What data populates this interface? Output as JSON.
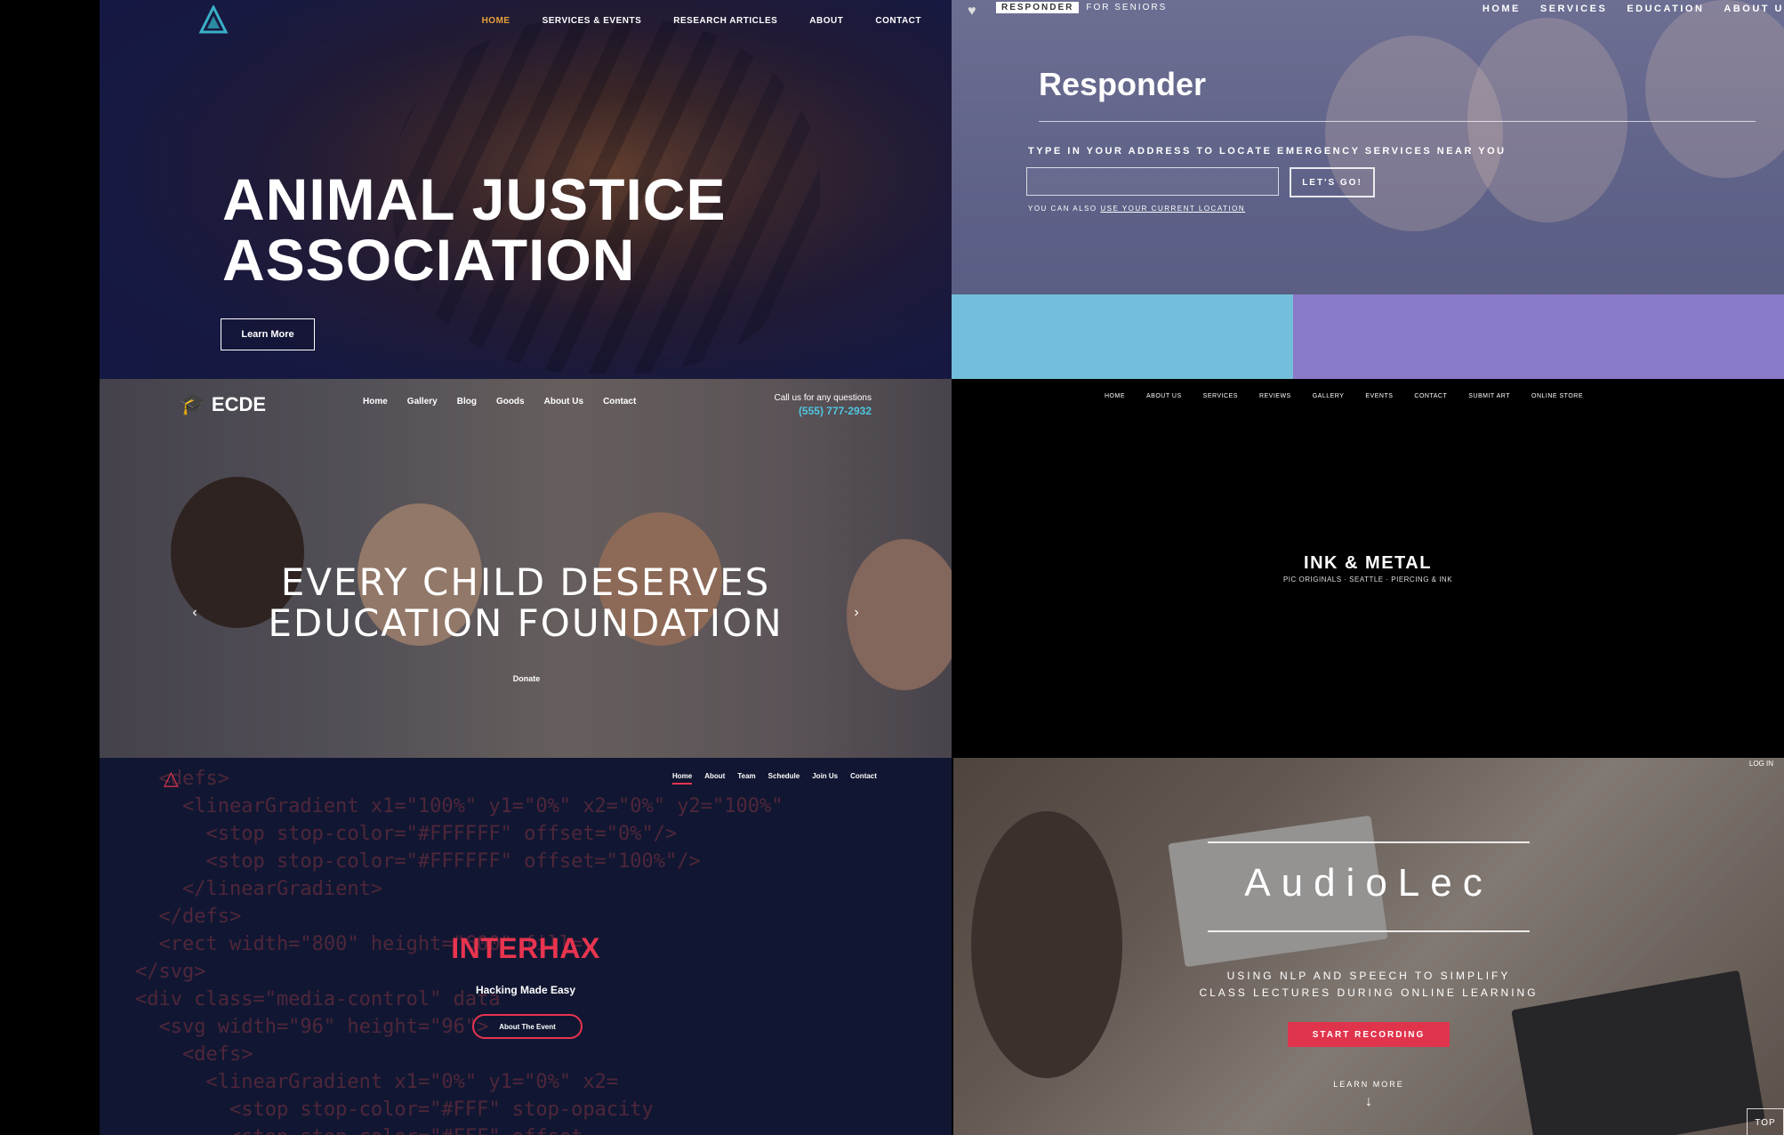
{
  "animal_justice": {
    "nav": [
      "HOME",
      "SERVICES & EVENTS",
      "RESEARCH ARTICLES",
      "ABOUT",
      "CONTACT"
    ],
    "title_line1": "ANIMAL JUSTICE",
    "title_line2": "ASSOCIATION",
    "button": "Learn More",
    "accent": "#e8a13a"
  },
  "responder": {
    "brand_box": "RESPONDER",
    "brand_suffix": "FOR SENIORS",
    "nav": [
      "HOME",
      "SERVICES",
      "EDUCATION",
      "ABOUT U"
    ],
    "title": "Responder",
    "label": "TYPE IN YOUR ADDRESS TO LOCATE EMERGENCY SERVICES NEAR YOU",
    "go_button": "LET'S GO!",
    "note_prefix": "YOU CAN ALSO",
    "note_link": "USE YOUR CURRENT LOCATION",
    "band_colors": [
      "#73bfdb",
      "#8a78c8"
    ]
  },
  "ecde": {
    "logo": "ECDE",
    "nav": [
      "Home",
      "Gallery",
      "Blog",
      "Goods",
      "About Us",
      "Contact"
    ],
    "call_label": "Call us for any questions",
    "phone": "(555) 777-2932",
    "title_line1": "EVERY CHILD DESERVES",
    "title_line2": "EDUCATION FOUNDATION",
    "donate": "Donate",
    "accent": "#5fd0e8"
  },
  "ink_metal": {
    "nav": [
      "HOME",
      "ABOUT US",
      "SERVICES",
      "REVIEWS",
      "GALLERY",
      "EVENTS",
      "CONTACT",
      "SUBMIT ART",
      "ONLINE STORE"
    ],
    "title": "INK & METAL",
    "subtitle": "PIC ORIGINALS · SEATTLE · PIERCING & INK"
  },
  "interhax": {
    "nav": [
      "Home",
      "About",
      "Team",
      "Schedule",
      "Join Us",
      "Contact"
    ],
    "code_lines": [
      "  <defs>",
      "    <linearGradient x1=\"100%\" y1=\"0%\" x2=\"0%\" y2=\"100%\"",
      "      <stop stop-color=\"#FFFFFF\" offset=\"0%\"/>",
      "      <stop stop-color=\"#FFFFFF\" offset=\"100%\"/>",
      "    </linearGradient>",
      "  </defs>",
      "  <rect width=\"800\" height=\"600\" fill=",
      "</svg>",
      "<div class=\"media-control\" data",
      "  <svg width=\"96\" height=\"96\">",
      "    <defs>",
      "      <linearGradient x1=\"0%\" y1=\"0%\" x2=",
      "        <stop stop-color=\"#FFF\" stop-opacity",
      "        <stop stop-color=\"#FFF\" offset"
    ],
    "title": "INTERHAX",
    "tagline": "Hacking Made Easy",
    "button": "About The Event",
    "accent": "#e8344f"
  },
  "audiolec": {
    "corner": "LOG IN",
    "title": "AudioLec",
    "sub_line1": "USING NLP AND SPEECH TO SIMPLIFY",
    "sub_line2": "CLASS LECTURES DURING ONLINE LEARNING",
    "cta": "START RECORDING",
    "learn": "LEARN MORE",
    "down_icon": "↓",
    "top": "TOP",
    "accent": "#e0344c"
  }
}
